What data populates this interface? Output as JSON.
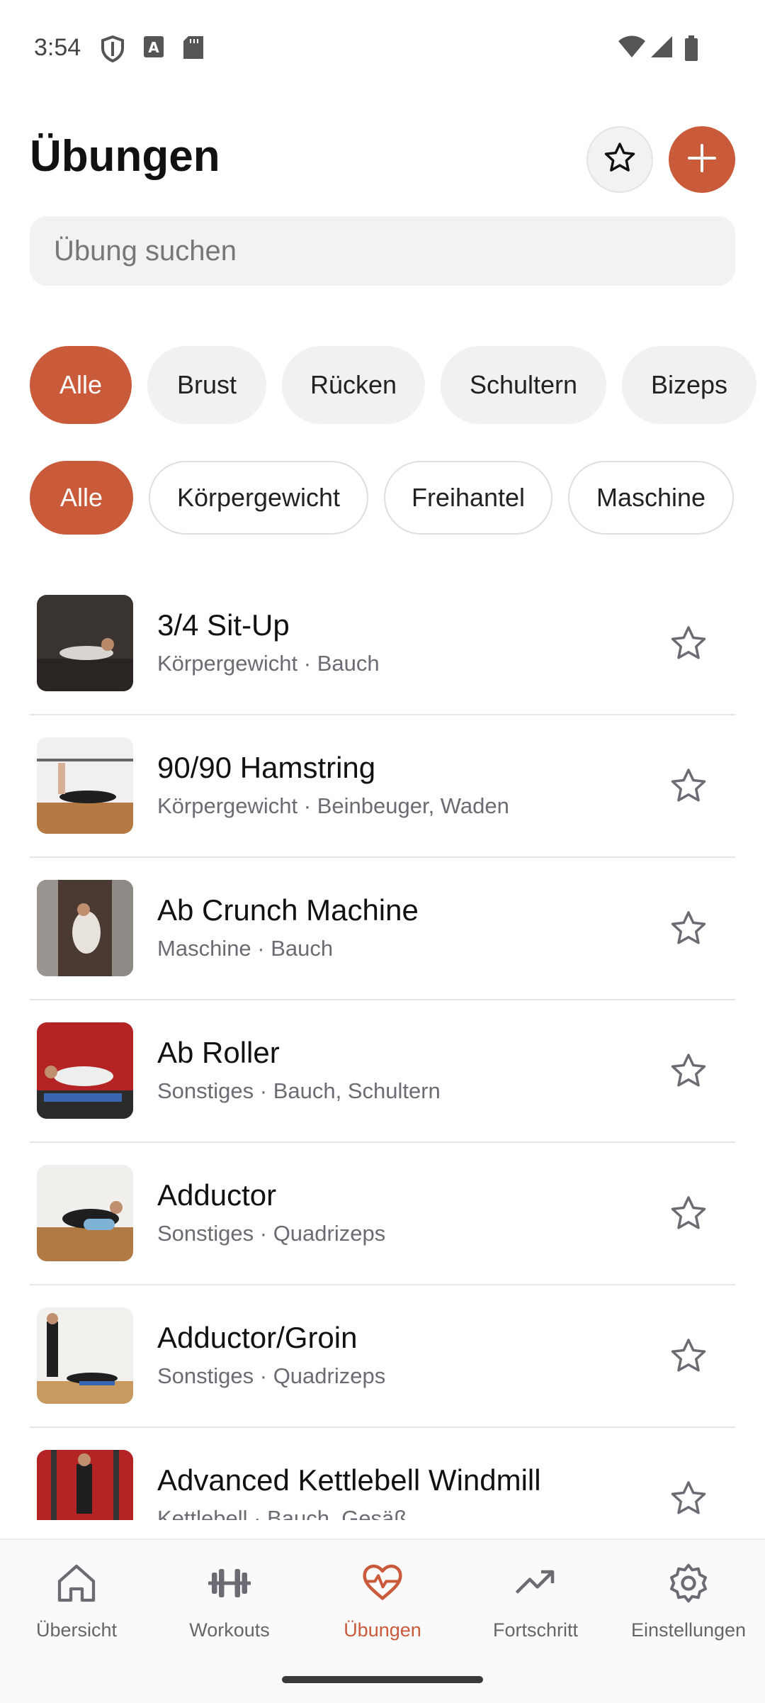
{
  "status_bar": {
    "time": "3:54",
    "icons": [
      "shield-icon",
      "a-badge-icon",
      "sd-card-icon",
      "wifi-icon",
      "signal-icon",
      "battery-icon"
    ]
  },
  "header": {
    "title": "Übungen",
    "favorites_icon": "star-outline-icon",
    "add_icon": "plus-icon"
  },
  "search": {
    "placeholder": "Übung suchen",
    "value": ""
  },
  "muscle_filters": [
    "Alle",
    "Brust",
    "Rücken",
    "Schultern",
    "Bizeps"
  ],
  "equipment_filters": [
    "Alle",
    "Körpergewicht",
    "Freihantel",
    "Maschine"
  ],
  "exercises": [
    {
      "name": "3/4 Sit-Up",
      "meta": "Körpergewicht · Bauch"
    },
    {
      "name": "90/90 Hamstring",
      "meta": "Körpergewicht · Beinbeuger, Waden"
    },
    {
      "name": "Ab Crunch Machine",
      "meta": "Maschine · Bauch"
    },
    {
      "name": "Ab Roller",
      "meta": "Sonstiges · Bauch, Schultern"
    },
    {
      "name": "Adductor",
      "meta": "Sonstiges · Quadrizeps"
    },
    {
      "name": "Adductor/Groin",
      "meta": "Sonstiges · Quadrizeps"
    },
    {
      "name": "Advanced Kettlebell Windmill",
      "meta": "Kettlebell · Bauch, Gesäß"
    }
  ],
  "nav": {
    "items": [
      {
        "label": "Übersicht",
        "icon": "home-icon"
      },
      {
        "label": "Workouts",
        "icon": "dumbbell-icon"
      },
      {
        "label": "Übungen",
        "icon": "heart-pulse-icon"
      },
      {
        "label": "Fortschritt",
        "icon": "trending-up-icon"
      },
      {
        "label": "Einstellungen",
        "icon": "gear-icon"
      }
    ],
    "active": "Übungen"
  },
  "colors": {
    "accent": "#c95a3a",
    "chip_bg": "#f1f1f3",
    "muted_text": "#6b6b73"
  }
}
